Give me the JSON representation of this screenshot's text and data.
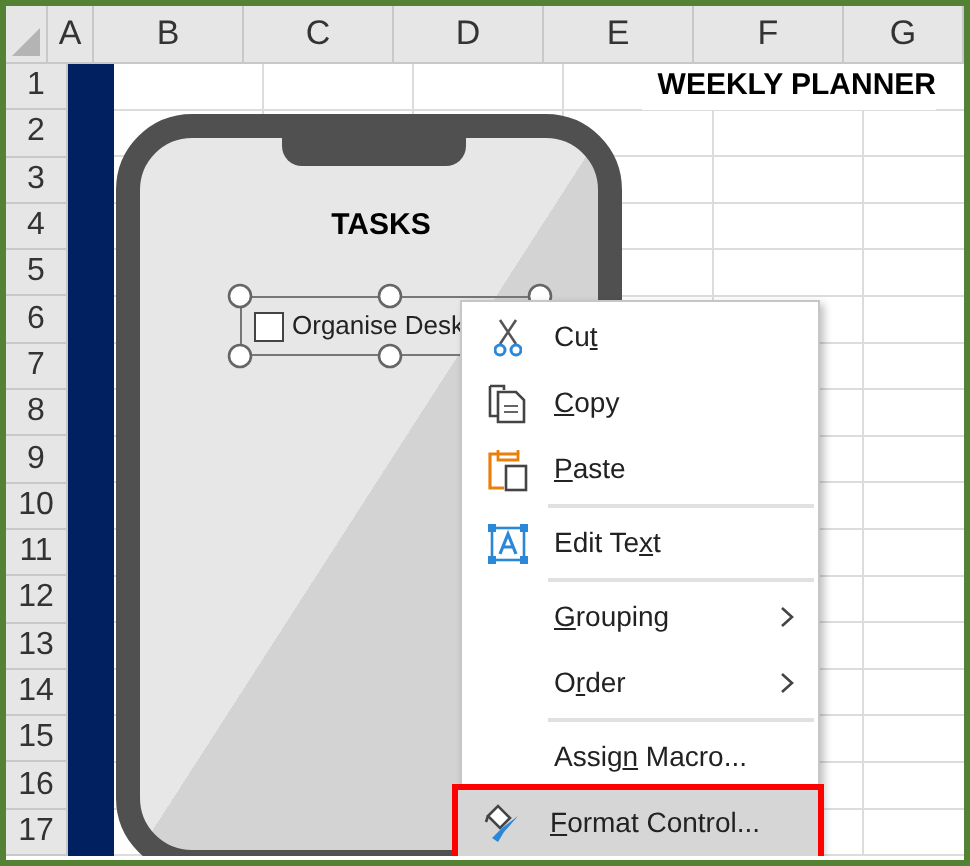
{
  "sheet": {
    "columns": [
      "A",
      "B",
      "C",
      "D",
      "E",
      "F",
      "G"
    ],
    "rows": [
      "1",
      "2",
      "3",
      "4",
      "5",
      "6",
      "7",
      "8",
      "9",
      "10",
      "11",
      "12",
      "13",
      "14",
      "15",
      "16",
      "17"
    ],
    "title": "WEEKLY PLANNER"
  },
  "phone": {
    "heading": "TASKS",
    "checkbox": {
      "label": "Organise Desk",
      "checked": false
    }
  },
  "context_menu": {
    "items": [
      {
        "kind": "item",
        "before": "Cu",
        "key": "t",
        "selected": false
      },
      {
        "kind": "item",
        "key": "C",
        "after": "opy",
        "selected": false
      },
      {
        "kind": "item",
        "key": "P",
        "after": "aste",
        "selected": false
      },
      {
        "kind": "separator"
      },
      {
        "kind": "item",
        "before": "Edit Te",
        "key": "x",
        "after": "t",
        "selected": false
      },
      {
        "kind": "separator"
      },
      {
        "kind": "submenu",
        "key": "G",
        "after": "rouping",
        "selected": false
      },
      {
        "kind": "submenu",
        "before": "O",
        "key": "r",
        "after": "der",
        "selected": false
      },
      {
        "kind": "separator"
      },
      {
        "kind": "item",
        "before": "Assig",
        "key": "n",
        "after": " Macro...",
        "selected": false
      },
      {
        "kind": "item",
        "key": "F",
        "after": "ormat Control...",
        "selected": true
      }
    ]
  }
}
